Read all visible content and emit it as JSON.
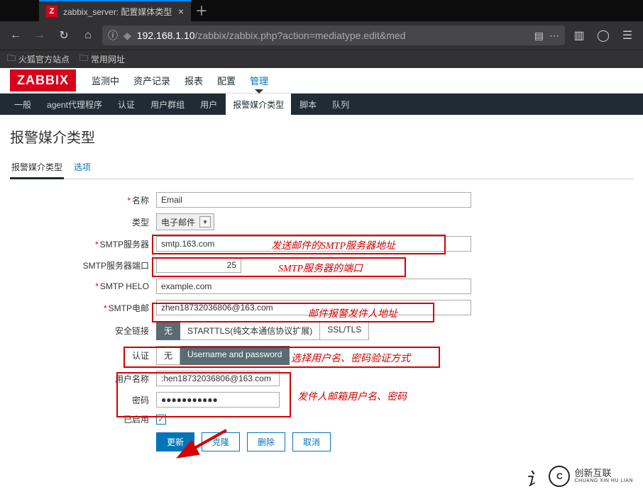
{
  "browser": {
    "tab_title": "zabbix_server: 配置媒体类型",
    "url_host": "192.168.1.10",
    "url_path": "/zabbix/zabbix.php?action=mediatype.edit&med",
    "bookmark_1": "火狐官方站点",
    "bookmark_2": "常用网址"
  },
  "header": {
    "logo": "ZABBIX",
    "nav": {
      "monitoring": "监测中",
      "inventory": "资产记录",
      "reports": "报表",
      "configuration": "配置",
      "administration": "管理"
    },
    "subnav": {
      "general": "一般",
      "agent_proxy": "agent代理程序",
      "auth": "认证",
      "usergroups": "用户群组",
      "users": "用户",
      "mediatype": "报警媒介类型",
      "scripts": "脚本",
      "queue": "队列"
    }
  },
  "page": {
    "title": "报警媒介类型",
    "tabs": {
      "mediatype": "报警媒介类型",
      "options": "选项"
    }
  },
  "labels": {
    "name": "名称",
    "type": "类型",
    "smtp_server": "SMTP服务器",
    "smtp_port": "SMTP服务器端口",
    "smtp_helo": "SMTP HELO",
    "smtp_email": "SMTP电邮",
    "security": "安全链接",
    "auth": "认证",
    "username": "用户名称",
    "password": "密码",
    "enabled": "已启用"
  },
  "values": {
    "name": "Email",
    "type": "电子邮件",
    "smtp_server": "smtp.163.com",
    "smtp_port": "25",
    "smtp_helo": "example.com",
    "smtp_email": "zhen18732036806@163.com",
    "username": ":hen18732036806@163.com",
    "password": "●●●●●●●●●●●"
  },
  "segments": {
    "sec_none": "无",
    "sec_starttls": "STARTTLS(纯文本通信协议扩展)",
    "sec_ssltls": "SSL/TLS",
    "auth_none": "无",
    "auth_userpass": "Username and password"
  },
  "buttons": {
    "update": "更新",
    "clone": "克隆",
    "delete": "删除",
    "cancel": "取消"
  },
  "annotations": {
    "smtp_server": "发送邮件的SMTP服务器地址",
    "smtp_port": "SMTP服务器的端口",
    "smtp_email": "邮件报警发件人地址",
    "auth_mode": "选择用户名、密码验证方式",
    "creds": "发件人邮箱用户名、密码"
  },
  "watermark": {
    "brand": "创新互联",
    "pinyin": "CHUANG XIN HU LIAN"
  }
}
